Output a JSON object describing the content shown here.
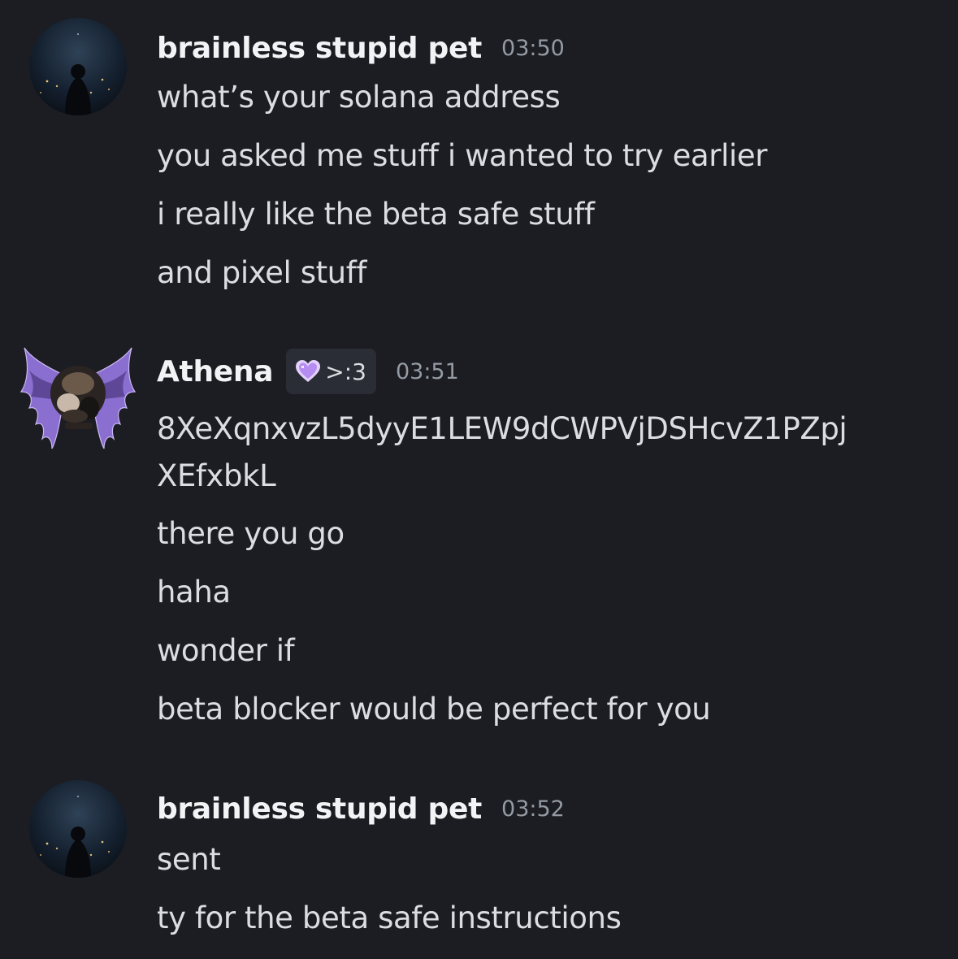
{
  "messages": [
    {
      "author": "brainless stupid pet",
      "time": "03:50",
      "lines": [
        "what’s your solana address",
        "you asked me stuff i wanted to try earlier",
        "i really like the beta safe stuff",
        "and pixel stuff"
      ]
    },
    {
      "author": "Athena",
      "role_tag": ">:3",
      "role_icon": "purple-heart-icon",
      "time": "03:51",
      "lines": [
        "8XeXqnxvzL5dyyE1LEW9dCWPVjDSHcvZ1PZpj",
        "XEfxbkL",
        "there you go",
        "haha",
        "wonder if",
        "beta blocker would be perfect for you"
      ]
    },
    {
      "author": "brainless stupid pet",
      "time": "03:52",
      "lines": [
        "sent",
        "ty for the beta safe instructions"
      ]
    }
  ],
  "colors": {
    "background": "#1c1d22",
    "username": "#f2f3f5",
    "text": "#dbdee1",
    "timestamp": "#949ba4",
    "role_tag_bg": "#2b2d36",
    "heart": "#c9a6f5"
  }
}
